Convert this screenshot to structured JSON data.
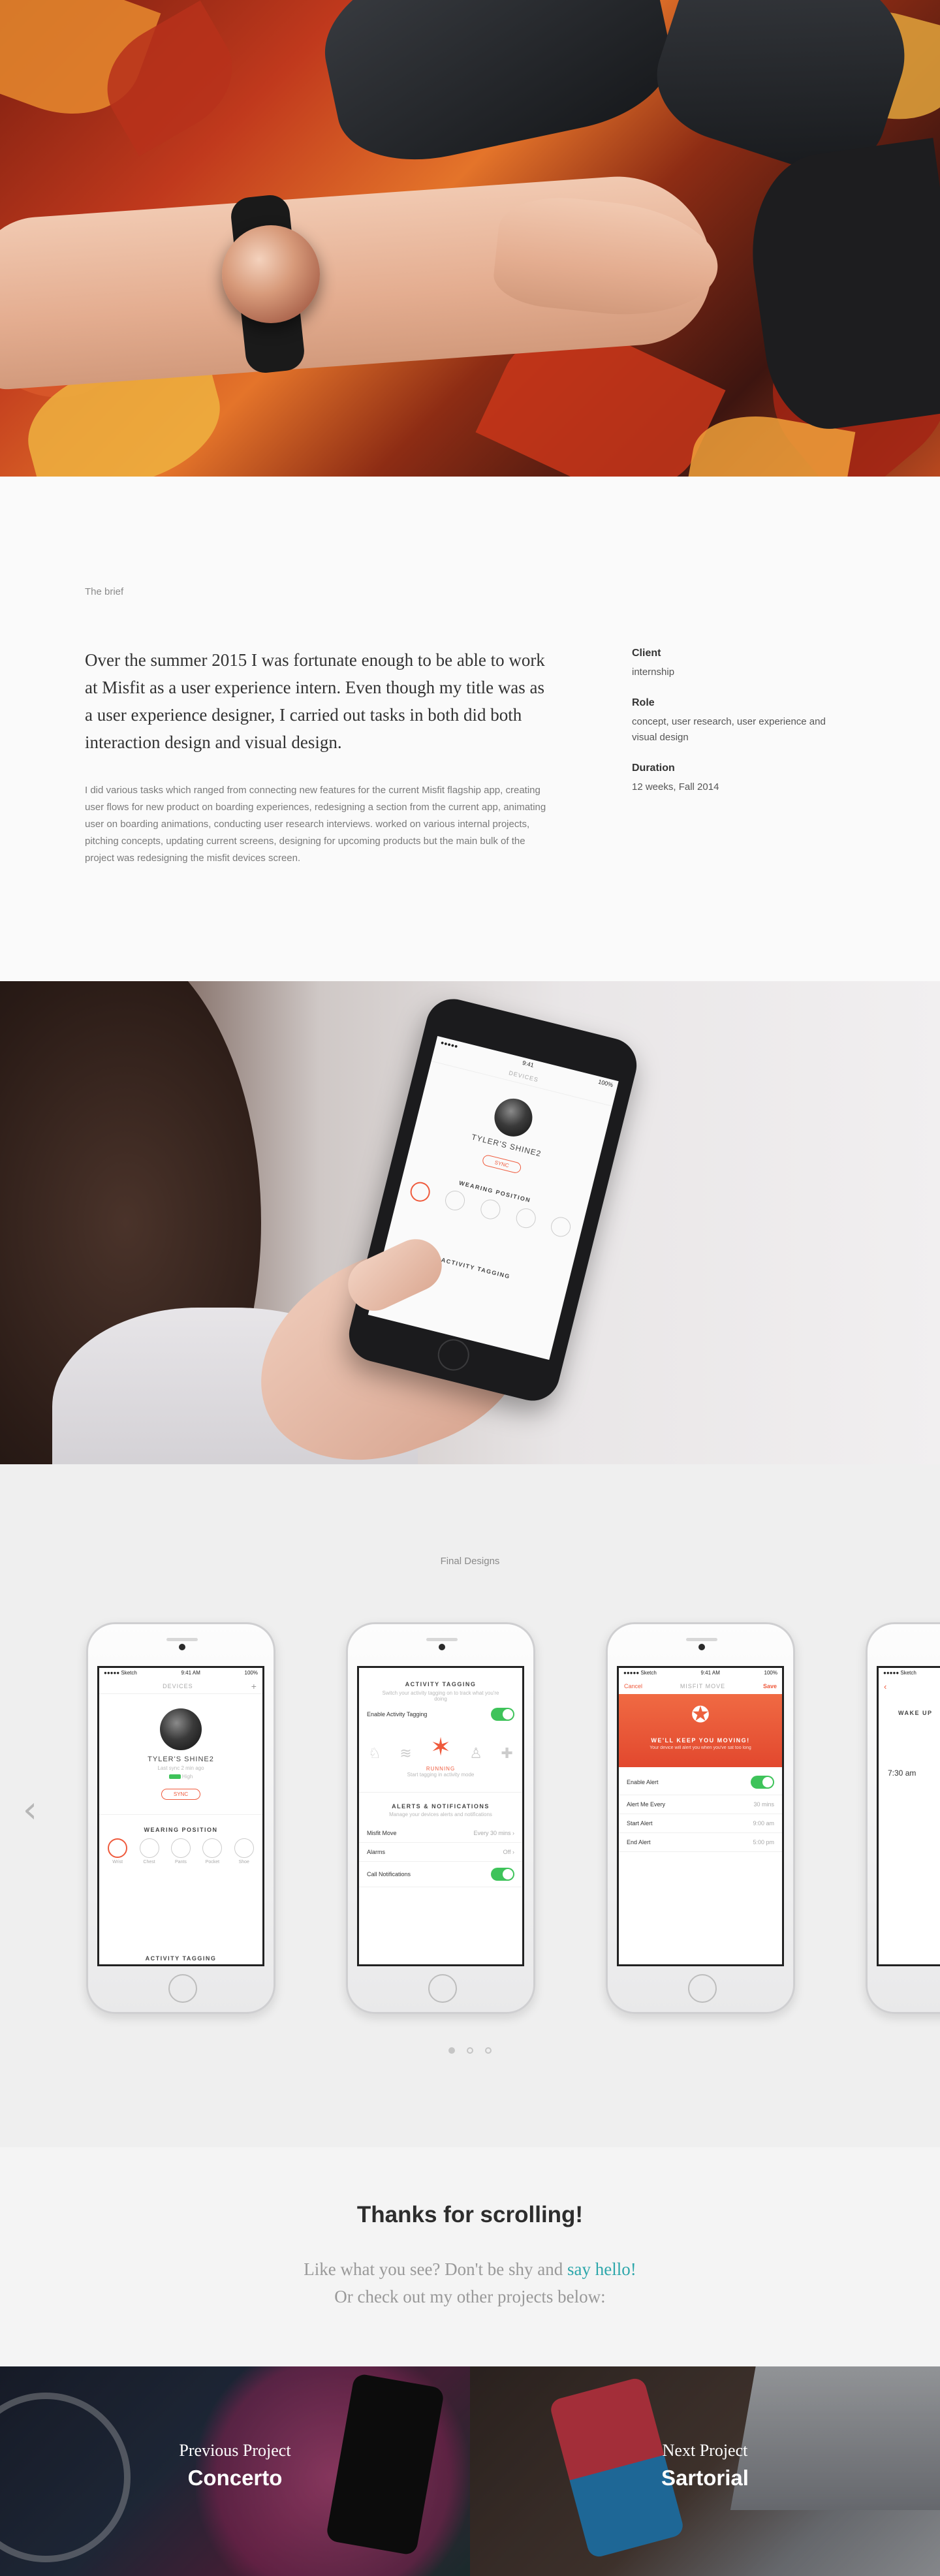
{
  "brief": {
    "label": "The brief",
    "lead": "Over the summer 2015 I was fortunate enough to be able to work at Misfit as a user experience intern. Even though my title was as a user experience designer, I carried out tasks in both did both interaction design and visual design.",
    "body": "I did various tasks which ranged from connecting new features for the current Misfit flagship app, creating user flows for new product on boarding experiences, redesigning a section from the current app, animating user on boarding animations, conducting user research interviews. worked on various internal projects, pitching concepts, updating current screens, designing for upcoming products but the main bulk of the project was redesigning the misfit devices screen.",
    "meta": [
      {
        "key": "Client",
        "value": "internship"
      },
      {
        "key": "Role",
        "value": "concept, user research, user experience and visual design"
      },
      {
        "key": "Duration",
        "value": "12 weeks, Fall 2014"
      }
    ]
  },
  "designs": {
    "title": "Final Designs",
    "phone1": {
      "status_left": "●●●●● Sketch",
      "status_time": "9:41 AM",
      "status_right": "100%",
      "nav_title": "DEVICES",
      "device_name": "TYLER'S SHINE2",
      "device_sub": "Last sync 2 min ago",
      "battery": "High",
      "sync_label": "SYNC",
      "wearing_title": "WEARING POSITION",
      "positions": [
        "Wrist",
        "Chest",
        "Pants",
        "Pocket",
        "Shoe"
      ],
      "footer_title": "ACTIVITY TAGGING"
    },
    "phone2": {
      "section1": "ACTIVITY TAGGING",
      "section1_desc": "Switch your activity tagging on to track what you're doing",
      "enable_label": "Enable Activity Tagging",
      "activity": "RUNNING",
      "activity_desc": "Start tagging in activity mode",
      "section2": "ALERTS & NOTIFICATIONS",
      "section2_desc": "Manage your devices alerts and notifications",
      "rows": [
        {
          "label": "Misfit Move",
          "value": "Every 30 mins"
        },
        {
          "label": "Alarms",
          "value": "Off"
        },
        {
          "label": "Call Notifications",
          "value": ""
        }
      ]
    },
    "phone3": {
      "cancel": "Cancel",
      "title": "MISFIT MOVE",
      "save": "Save",
      "banner": "WE'LL KEEP YOU MOVING!",
      "banner_sub": "Your device will alert you when you've sat too long",
      "rows": [
        {
          "label": "Enable Alert",
          "value": ""
        },
        {
          "label": "Alert Me Every",
          "value": "30 mins"
        },
        {
          "label": "Start Alert",
          "value": "9:00 am"
        },
        {
          "label": "End Alert",
          "value": "5:00 pm"
        }
      ]
    },
    "phone4": {
      "title": "WAKE UP",
      "time": "7:30 am"
    },
    "big_phone": {
      "nav_title": "DEVICES",
      "device_name": "TYLER'S SHINE2",
      "sync_label": "SYNC",
      "wearing_title": "WEARING POSITION",
      "footer_title": "ACTIVITY TAGGING"
    },
    "prev_arrow": "‹",
    "next_arrow": "›"
  },
  "thanks": {
    "title": "Thanks for scrolling!",
    "line1_pre": "Like what you see? Don't be shy and ",
    "line1_link": "say hello!",
    "line2": "Or check out my other projects below:"
  },
  "projects": {
    "prev": {
      "pre": "Previous Project",
      "name": "Concerto"
    },
    "next": {
      "pre": "Next Project",
      "name": "Sartorial"
    }
  },
  "colors": {
    "accent": "#ef5a3c",
    "link": "#2ea7ab",
    "toggle": "#3ec35a"
  }
}
